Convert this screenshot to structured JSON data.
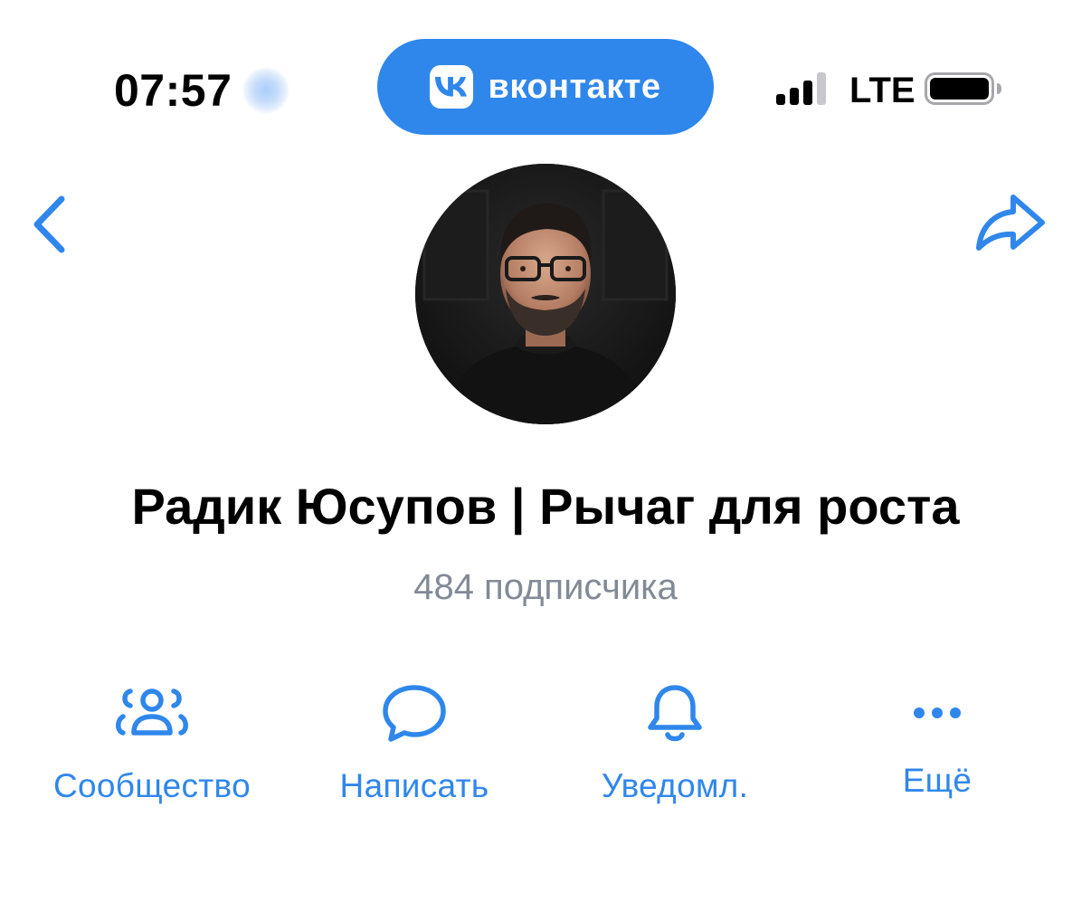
{
  "status_bar": {
    "time": "07:57",
    "app_badge_label": "вконтакте",
    "network": "LTE",
    "signal_icon": "cellular-signal-icon",
    "battery_icon": "battery-icon"
  },
  "nav": {
    "back_icon": "chevron-left-icon",
    "share_icon": "share-arrow-icon"
  },
  "profile": {
    "name": "Радик Юсупов | Рычаг для роста",
    "subscribers": "484 подписчика"
  },
  "actions": [
    {
      "label": "Сообщество",
      "icon": "community-icon"
    },
    {
      "label": "Написать",
      "icon": "message-bubble-icon"
    },
    {
      "label": "Уведомл.",
      "icon": "bell-icon"
    },
    {
      "label": "Ещё",
      "icon": "more-dots-icon"
    }
  ],
  "colors": {
    "accent": "#2f87eb",
    "text_primary": "#000000",
    "text_secondary": "#828a96",
    "background": "#ffffff"
  }
}
